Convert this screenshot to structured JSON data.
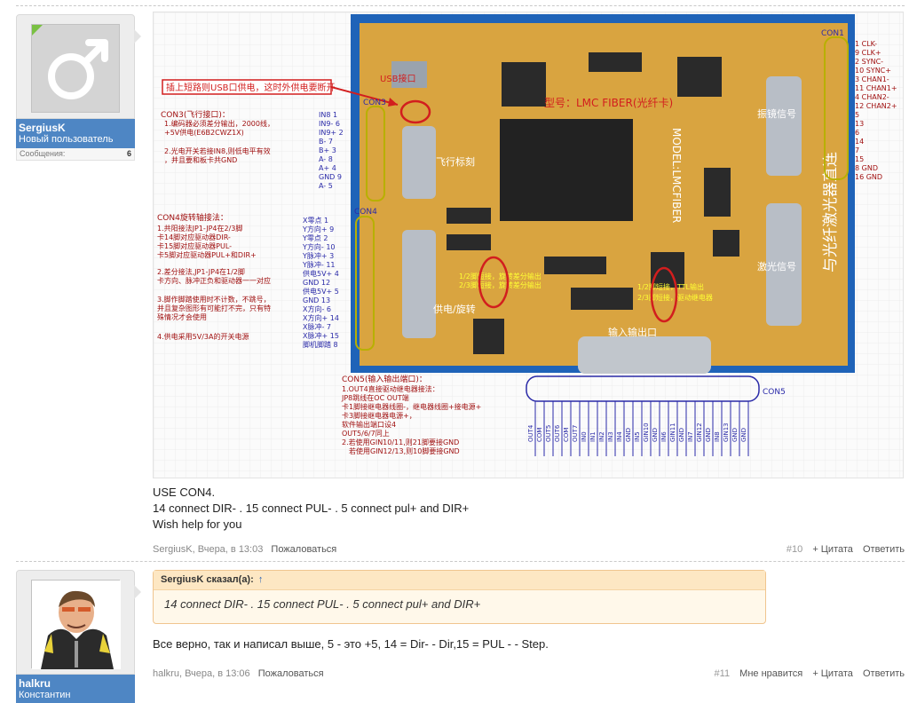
{
  "post1": {
    "user": {
      "name": "SergiusK",
      "title": "Новый пользователь",
      "stat_label": "Сообщения:",
      "stat_value": "6"
    },
    "image": {
      "usb_note": "插上短路则USB口供电，这时外供电要断开",
      "usb_port": "USB接口",
      "model_label": "型号：LMC FIBER(光纤卡)",
      "model_text": "MODEL:LMCFIBER",
      "galvo": "振镜信号",
      "laser": "激光信号",
      "flight": "飞行标刻",
      "power_rot": "供电/旋转",
      "io_label": "输入输出口",
      "vertical_title": "与光纤激光器直连",
      "con1_label": "CON1",
      "con3_label": "CON3",
      "con4_label": "CON4",
      "con5_label": "CON5",
      "con1_pins": [
        "1 CLK-",
        "9 CLK+",
        "2 SYNC-",
        "10 SYNC+",
        "3 CHAN1-",
        "11 CHAN1+",
        "4 CHAN2-",
        "12 CHAN2+",
        "5",
        "13",
        "6",
        "14",
        "7",
        "15",
        "8 GND",
        "16 GND"
      ],
      "con3_title": "CON3(飞行接口)：",
      "con3_notes": [
        "1.编码器必须差分输出，2000线，",
        "+5V供电(E6B2CWZ1X)",
        "2.光电开关若接IN8,则低电平有效",
        "，并且要和板卡共GND"
      ],
      "con3_pins": [
        "IN8 1",
        "IN9- 6",
        "IN9+ 2",
        "B- 7",
        "B+ 3",
        "A- 8",
        "A+ 4",
        "GND 9",
        "A- 5"
      ],
      "con4_title": "CON4旋转轴接法：",
      "con4_notes": [
        "1.共阳接法JP1-JP4在2/3脚",
        "卡14脚对应驱动器DIR-",
        "卡15脚对应驱动器PUL-",
        "卡5脚对应驱动器PUL+和DIR+",
        "2.差分接法,JP1-JP4在1/2脚",
        "卡方向、脉冲正负和驱动器一一对应",
        "3.脚作脚踏使用时不计数，不跳号，",
        "并且复杂图形有可能打不完，只有特",
        "殊情况才会使用",
        "4.供电采用5V/3A的开关电源"
      ],
      "con4_pins": [
        "X零点 1",
        "Y方向+ 9",
        "Y零点 2",
        "Y方向- 10",
        "Y脉冲+ 3",
        "Y脉冲- 11",
        "供电5V+ 4",
        "GND 12",
        "供电5V+ 5",
        "GND 13",
        "X方向- 6",
        "X方向+ 14",
        "X脉冲- 7",
        "X脉冲+ 15",
        "脚机脚踏 8"
      ],
      "jp_note1": "1/2脚短接，旋转差分输出",
      "jp_note2": "2/3脚短接，旋转差分输出",
      "relay_note1": "1/2脚短接，TTL输出",
      "relay_note2": "2/3脚短接，驱动继电器",
      "con5_title": "CON5(输入输出端口)：",
      "con5_notes": [
        "1.OUT4直接驱动继电器接法：",
        "JP8跳线在OC OUT端",
        "卡1脚接继电器线圈-，继电器线圈+接电源+",
        "卡3脚接继电器电源+，",
        "软件输出端口设4",
        "OUT5/6/7同上",
        "2.若使用GIN10/11,则21脚要接GND",
        "若使用GIN12/13,则10脚要接GND"
      ],
      "con5_pins": [
        "OUT4",
        "COM",
        "OUT5",
        "OUT6",
        "COM",
        "OUT7",
        "IN0",
        "IN1",
        "IN2",
        "IN3",
        "IN4",
        "GND",
        "IN5",
        "GIN10",
        "GND",
        "IN6",
        "GIN11",
        "GND",
        "IN7",
        "GIN12",
        "GND",
        "IN8",
        "GIN13",
        "GND",
        "GND"
      ]
    },
    "body": [
      "USE CON4.",
      "14 connect DIR- . 15 connect PUL- . 5 connect pul+ and DIR+",
      "Wish help for you"
    ],
    "footer": {
      "author_time": "SergiusK, Вчера, в 13:03",
      "report": "Пожаловаться",
      "number": "#10",
      "quote": "+ Цитата",
      "reply": "Ответить"
    }
  },
  "post2": {
    "user": {
      "name": "halkru",
      "title": "Константин"
    },
    "quote": {
      "header": "SergiusK сказал(а):",
      "arrow": "↑",
      "text": "14 connect DIR- . 15 connect PUL- . 5 connect pul+ and DIR+"
    },
    "body": "Все верно, так и написал выше, 5 - это +5, 14 = Dir- - Dir,15 = PUL - - Step.",
    "footer": {
      "author_time": "halkru, Вчера, в 13:06",
      "report": "Пожаловаться",
      "number": "#11",
      "like": "Мне нравится",
      "quote": "+ Цитата",
      "reply": "Ответить"
    }
  },
  "colors": {
    "accent": "#4e86c4",
    "quote_bg": "#fff8ea",
    "quote_border": "#f0c58f",
    "pcb": "#d9a440",
    "annotation_red": "#d21e1e",
    "pin_blue": "#2a2aa8"
  }
}
